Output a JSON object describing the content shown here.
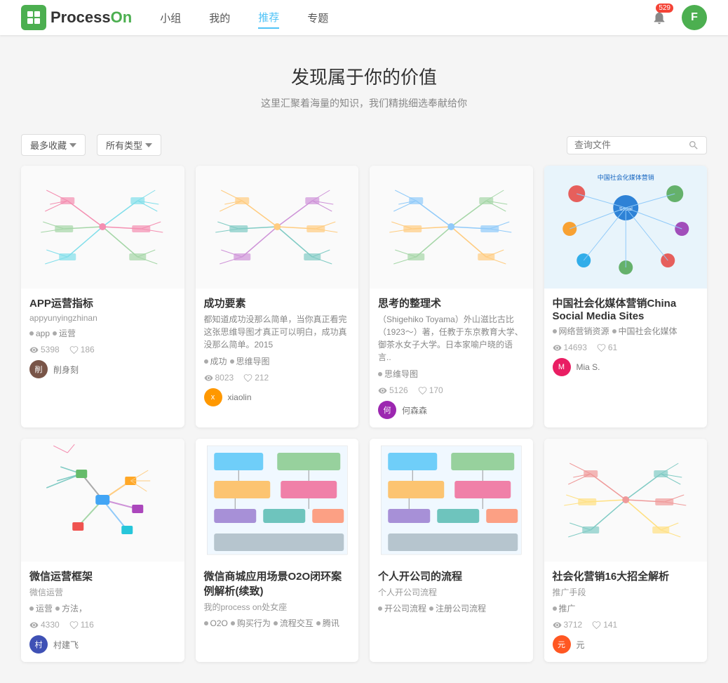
{
  "header": {
    "logo_text_process": "Process",
    "logo_text_on": "On",
    "nav_items": [
      {
        "label": "小组",
        "active": false
      },
      {
        "label": "我的",
        "active": false
      },
      {
        "label": "推荐",
        "active": true
      },
      {
        "label": "专题",
        "active": false
      }
    ],
    "notification_count": "529",
    "avatar_letter": "F"
  },
  "hero": {
    "title": "发现属于你的价值",
    "subtitle": "这里汇聚着海量的知识，我们精挑细选奉献给你"
  },
  "filter": {
    "sort_label": "最多收藏",
    "type_label": "所有类型",
    "search_placeholder": "查询文件"
  },
  "cards": [
    {
      "id": "card-1",
      "title": "APP运营指标",
      "author_name": "appyunyingzhinan",
      "tags": [
        "app",
        "运营"
      ],
      "views": "5398",
      "likes": "186",
      "user_name": "削身刻",
      "user_color": "#795548",
      "description": ""
    },
    {
      "id": "card-2",
      "title": "成功要素",
      "author_name": "",
      "tags": [
        "成功",
        "思维导图"
      ],
      "views": "8023",
      "likes": "212",
      "user_name": "xiaolin",
      "user_color": "#ff9800",
      "description": "都知道成功没那么简单，当你真正看完这张思维导图才真正可以明白，成功真没那么简单。2015"
    },
    {
      "id": "card-3",
      "title": "思考的整理术",
      "author_name": "",
      "tags": [
        "思维导图"
      ],
      "views": "5126",
      "likes": "170",
      "user_name": "何森森",
      "user_color": "#9c27b0",
      "description": "（Shigehiko Toyama）外山滋比古比（1923～）著，任教于东京教育大学、御茶水女子大学。日本家喻户晓的语言.."
    },
    {
      "id": "card-4",
      "title": "中国社会化媒体营销China Social Media Sites",
      "author_name": "",
      "tags": [
        "网络营销资源",
        "中国社会化媒体"
      ],
      "views": "14693",
      "likes": "61",
      "user_name": "Mia S.",
      "user_color": "#e91e63",
      "description": ""
    },
    {
      "id": "card-5",
      "title": "微信运营框架",
      "author_name": "微信运营",
      "tags": [
        "运营",
        "方法，"
      ],
      "views": "4330",
      "likes": "116",
      "user_name": "村建飞",
      "user_color": "#3f51b5",
      "description": ""
    },
    {
      "id": "card-6",
      "title": "微信商城应用场景O2O闭环案例解析(续致)",
      "author_name": "我的process on处女座",
      "tags": [
        "O2O",
        "购买行为",
        "流程交互",
        "腾讯"
      ],
      "views": "",
      "likes": "",
      "user_name": "",
      "user_color": "#607d8b",
      "description": ""
    },
    {
      "id": "card-7",
      "title": "个人开公司的流程",
      "author_name": "个人开公司流程",
      "tags": [
        "开公司流程",
        "注册公司流程"
      ],
      "views": "",
      "likes": "",
      "user_name": "",
      "user_color": "#009688",
      "description": ""
    },
    {
      "id": "card-8",
      "title": "社会化营销16大招全解析",
      "author_name": "推广手段",
      "tags": [
        "推广"
      ],
      "views": "3712",
      "likes": "141",
      "user_name": "元",
      "user_color": "#ff5722",
      "description": ""
    }
  ]
}
